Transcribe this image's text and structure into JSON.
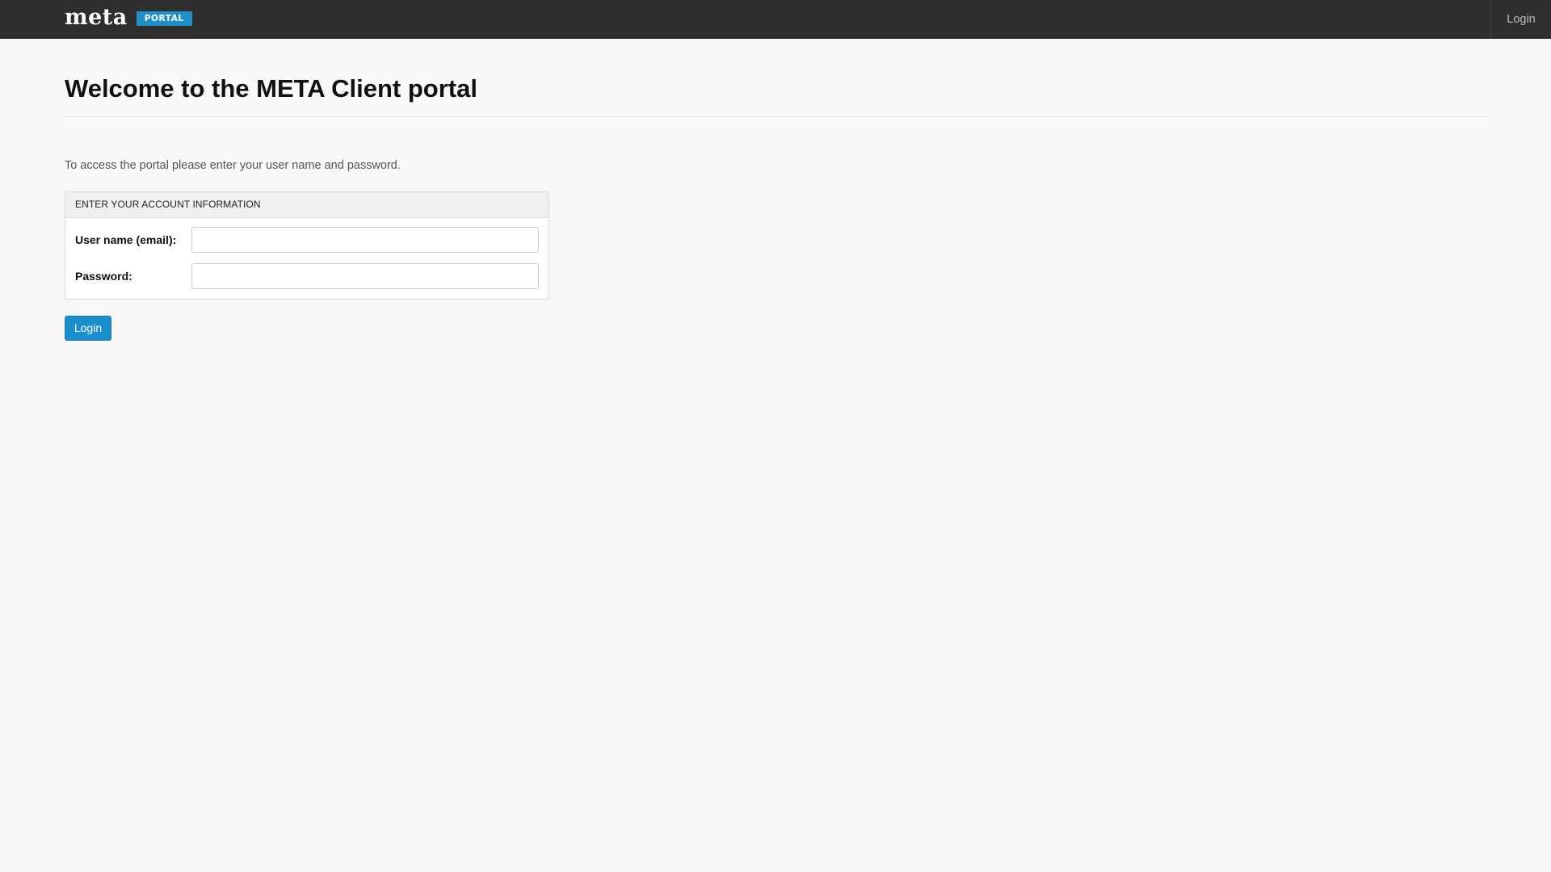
{
  "navbar": {
    "brand_word": "meta",
    "brand_tag": "PORTAL",
    "login_link": "Login"
  },
  "main": {
    "title": "Welcome to the META Client portal",
    "intro": "To access the portal please enter your user name and password.",
    "panel": {
      "heading": "ENTER YOUR ACCOUNT INFORMATION",
      "username_label": "User name (email):",
      "username_value": "",
      "username_placeholder": "",
      "password_label": "Password:",
      "password_value": "",
      "password_placeholder": ""
    },
    "login_button": "Login"
  },
  "colors": {
    "navbar_bg": "#2e2e2e",
    "brand_tag_bg": "#1e90c8",
    "button_bg": "#1a8fcc",
    "page_bg": "#f8f8f8"
  }
}
